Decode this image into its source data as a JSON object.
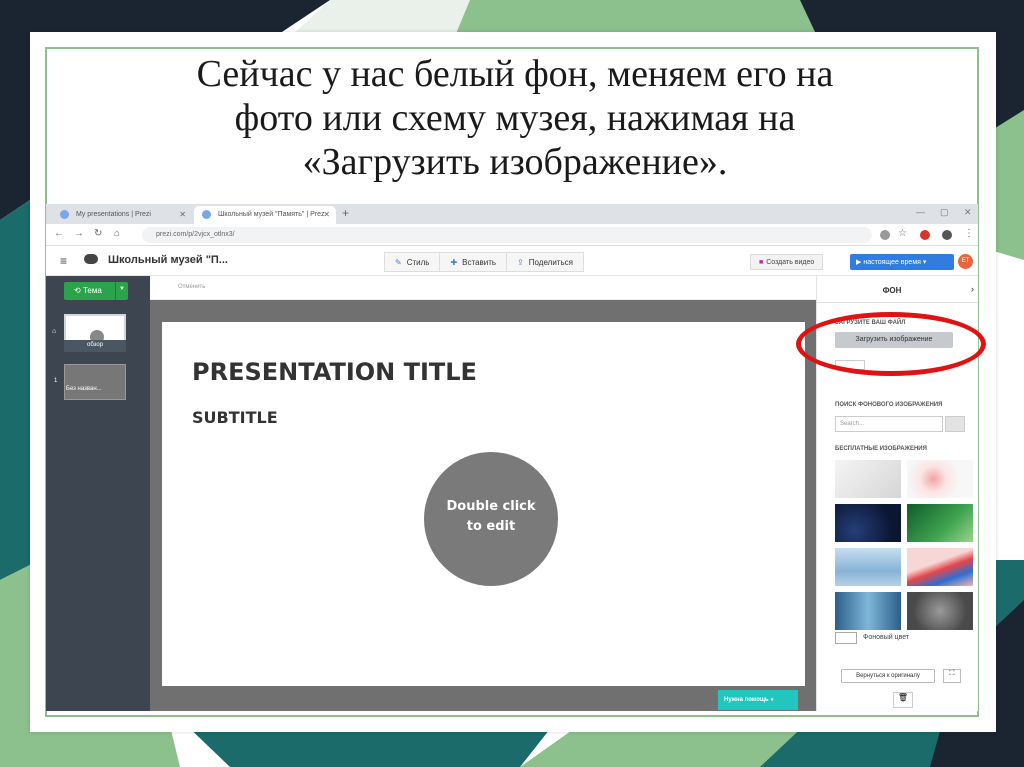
{
  "slide": {
    "heading_lines": [
      "Сейчас у нас белый фон, меняем его на",
      "фото или схему музея, нажимая на",
      "«Загрузить изображение»."
    ]
  },
  "browser": {
    "tabs": [
      {
        "label": "My presentations | Prezi",
        "close": "✕"
      },
      {
        "label": "Школьный музей \"Память\" | Prez",
        "close": "✕"
      }
    ],
    "new_tab": "+",
    "url": "prezi.com/p/2vjcx_otlnx3/"
  },
  "app": {
    "title": "Школьный музей \"П...",
    "toolbar": {
      "style_label": "Стиль",
      "insert_label": "Вставить",
      "share_label": "Поделиться"
    },
    "create_video_label": "Создать видео",
    "present_label": "настоящее время",
    "avatar_initials": "ET"
  },
  "sidebar": {
    "theme_label": "Тема",
    "items": [
      {
        "label": "обзор"
      },
      {
        "number": "1",
        "label": "Без назван..."
      }
    ]
  },
  "canvas": {
    "undo_label": "Отменить",
    "title": "PRESENTATION TITLE",
    "subtitle": "SUBTITLE",
    "placeholder_line1": "Double click",
    "placeholder_line2": "to edit",
    "help_label": "Нужна помощь"
  },
  "right_panel": {
    "title": "ФОН",
    "upload_section": "ЗАГРУЗИТЕ ВАШ ФАЙЛ",
    "upload_button": "Загрузить изображение",
    "search_section": "ПОИСК ФОНОВОГО ИЗОБРАЖЕНИЯ",
    "search_placeholder": "Search...",
    "free_images_section": "БЕСПЛАТНЫЕ ИЗОБРАЖЕНИЯ",
    "bg_color_label": "Фоновый цвет",
    "revert_label": "Вернуться к оригиналу"
  },
  "colors": {
    "highlight": "#e11212",
    "present_button": "#2f7de1",
    "theme_button": "#2aa34a",
    "help_button": "#21c6bf",
    "slide_bg_teal": "#1c6b6b",
    "slide_bg_green": "#8cc08c",
    "slide_bg_navy": "#1b2431"
  }
}
